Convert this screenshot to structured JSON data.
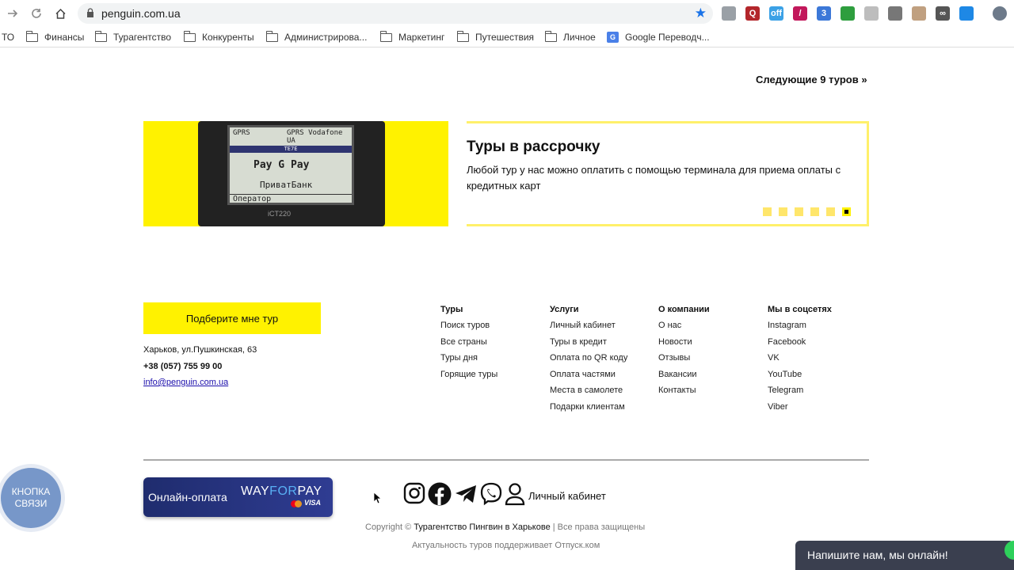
{
  "browser": {
    "url": "penguin.com.ua",
    "bookmarks": [
      {
        "label": "ТО",
        "icon": "none"
      },
      {
        "label": "Финансы",
        "icon": "folder-icon"
      },
      {
        "label": "Турагентство",
        "icon": "folder-icon"
      },
      {
        "label": "Конкуренты",
        "icon": "folder-icon"
      },
      {
        "label": "Администрирова...",
        "icon": "folder-icon"
      },
      {
        "label": "Маркетинг",
        "icon": "folder-icon"
      },
      {
        "label": "Путешествия",
        "icon": "folder-icon"
      },
      {
        "label": "Личное",
        "icon": "folder-icon"
      },
      {
        "label": "Google Переводч...",
        "icon": "google-translate-icon"
      }
    ],
    "extensions": [
      {
        "name": "globe-extension-icon",
        "glyph": "",
        "color": "#9aa0a6"
      },
      {
        "name": "q-extension-icon",
        "glyph": "Q",
        "color": "#b3262b"
      },
      {
        "name": "off-extension-icon",
        "glyph": "off",
        "color": "#3ba1e6"
      },
      {
        "name": "pen-extension-icon",
        "glyph": "/",
        "color": "#c2185b"
      },
      {
        "name": "wa-extension-icon",
        "glyph": "3",
        "color": "#3c78d8"
      },
      {
        "name": "green-extension-icon",
        "glyph": "",
        "color": "#2e9e3e"
      },
      {
        "name": "grey-extension-icon",
        "glyph": "",
        "color": "#bdbdbd"
      },
      {
        "name": "puzzle-extension-icon",
        "glyph": "",
        "color": "#777777"
      },
      {
        "name": "face-extension-icon",
        "glyph": "",
        "color": "#c0a080"
      },
      {
        "name": "infinity-extension-icon",
        "glyph": "∞",
        "color": "#555555"
      },
      {
        "name": "shield-extension-icon",
        "glyph": "",
        "color": "#1e88e5"
      },
      {
        "name": "profile-avatar-icon",
        "glyph": "",
        "color": "#6d7a8a"
      }
    ]
  },
  "next_tours": "Следующие 9 туров »",
  "promo": {
    "terminal_top_left": "GPRS",
    "terminal_top_right": "GPRS Vodafone UA",
    "terminal_header": "TE7E",
    "terminal_pay": " Pay  G Pay",
    "terminal_bank": "ПриватБанк",
    "terminal_operator": "Оператор",
    "terminal_model": "iCT220",
    "title": "Туры в рассрочку",
    "text": "Любой тур у нас можно оплатить с помощью терминала для приема оплаты с кредитных карт",
    "slides_total": 6,
    "active_slide": 6
  },
  "footer": {
    "cta_label": "Подберите мне тур",
    "address": "Харьков, ул.Пушкинская, 63",
    "phone": "+38 (057) 755 99 00",
    "email": "info@penguin.com.ua",
    "columns": [
      {
        "title": "Туры",
        "items": [
          "Поиск туров",
          "Все страны",
          "Туры дня",
          "Горящие туры"
        ]
      },
      {
        "title": "Услуги",
        "items": [
          "Личный кабинет",
          "Туры в кредит",
          "Оплата по QR коду",
          "Оплата частями",
          "Места в самолете",
          "Подарки клиентам"
        ]
      },
      {
        "title": "О компании",
        "items": [
          "О нас",
          "Новости",
          "Отзывы",
          "Вакансии",
          "Контакты"
        ]
      },
      {
        "title": "Мы в соцсетях",
        "items": [
          "Instagram",
          "Facebook",
          "VK",
          "YouTube",
          "Telegram",
          "Viber"
        ]
      }
    ],
    "payment": {
      "label": "Онлайн-оплата",
      "brand_a": "WAY",
      "brand_b": "FOR",
      "brand_c": "PAY",
      "visa": "VISA"
    },
    "cabinet_link": "Личный кабинет",
    "copyright_prefix": "Copyright ©",
    "copyright_company": "Турагентство Пингвин в Харькове",
    "copyright_suffix": "| Все права защищены",
    "actuality": "Актуальность туров поддерживает Отпуск.ком"
  },
  "widgets": {
    "contact_button_line1": "КНОПКА",
    "contact_button_line2": "СВЯЗИ",
    "chat_label": "Напишите нам, мы онлайн!"
  },
  "colors": {
    "accent_yellow": "#fff200",
    "payment_blue": "#1f2c6e",
    "chat_bg": "#3a3f4f",
    "contact_btn": "#7797c9"
  }
}
